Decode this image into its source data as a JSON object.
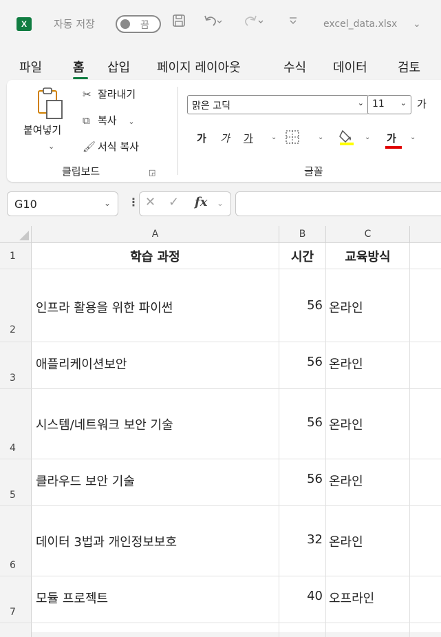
{
  "titlebar": {
    "app_icon": "X",
    "autosave_label": "자동 저장",
    "autosave_state": "끔",
    "filename": "excel_data.xlsx",
    "filename_caret": "⌄",
    "icons": [
      "save-icon",
      "undo-icon",
      "redo-icon",
      "customize-icon"
    ]
  },
  "tabs": [
    "파일",
    "홈",
    "삽입",
    "페이지 레이아웃",
    "수식",
    "데이터",
    "검토"
  ],
  "ribbon": {
    "clipboard": {
      "paste_label": "붙여넣기",
      "cut_label": "잘라내기",
      "copy_label": "복사",
      "format_painter_label": "서식 복사",
      "group_label": "클립보드"
    },
    "font": {
      "font_name": "맑은 고딕",
      "font_size": "11",
      "group_label": "글꼴",
      "grow_label": "가",
      "bold_label": "가",
      "italic_label": "가",
      "underline_label": "가",
      "font_color_label": "가",
      "highlight_color": "#ffff00",
      "font_color": "#e00000"
    }
  },
  "formula_bar": {
    "name_box": "G10",
    "fx_label": "fx",
    "value": ""
  },
  "sheet": {
    "columns": [
      "A",
      "B",
      "C"
    ],
    "header": [
      "학습 과정",
      "시간",
      "교육방식"
    ],
    "rows": [
      {
        "num": "2",
        "course": "인프라 활용을 위한 파이썬",
        "hours": "56",
        "mode": "온라인"
      },
      {
        "num": "3",
        "course": "애플리케이션보안",
        "hours": "56",
        "mode": "온라인"
      },
      {
        "num": "4",
        "course": "시스템/네트워크 보안 기술",
        "hours": "56",
        "mode": "온라인"
      },
      {
        "num": "5",
        "course": "클라우드 보안 기술",
        "hours": "56",
        "mode": "온라인"
      },
      {
        "num": "6",
        "course": "데이터 3법과 개인정보보호",
        "hours": "32",
        "mode": "온라인"
      },
      {
        "num": "7",
        "course": "모듈 프로젝트",
        "hours": "40",
        "mode": "오프라인"
      }
    ]
  }
}
